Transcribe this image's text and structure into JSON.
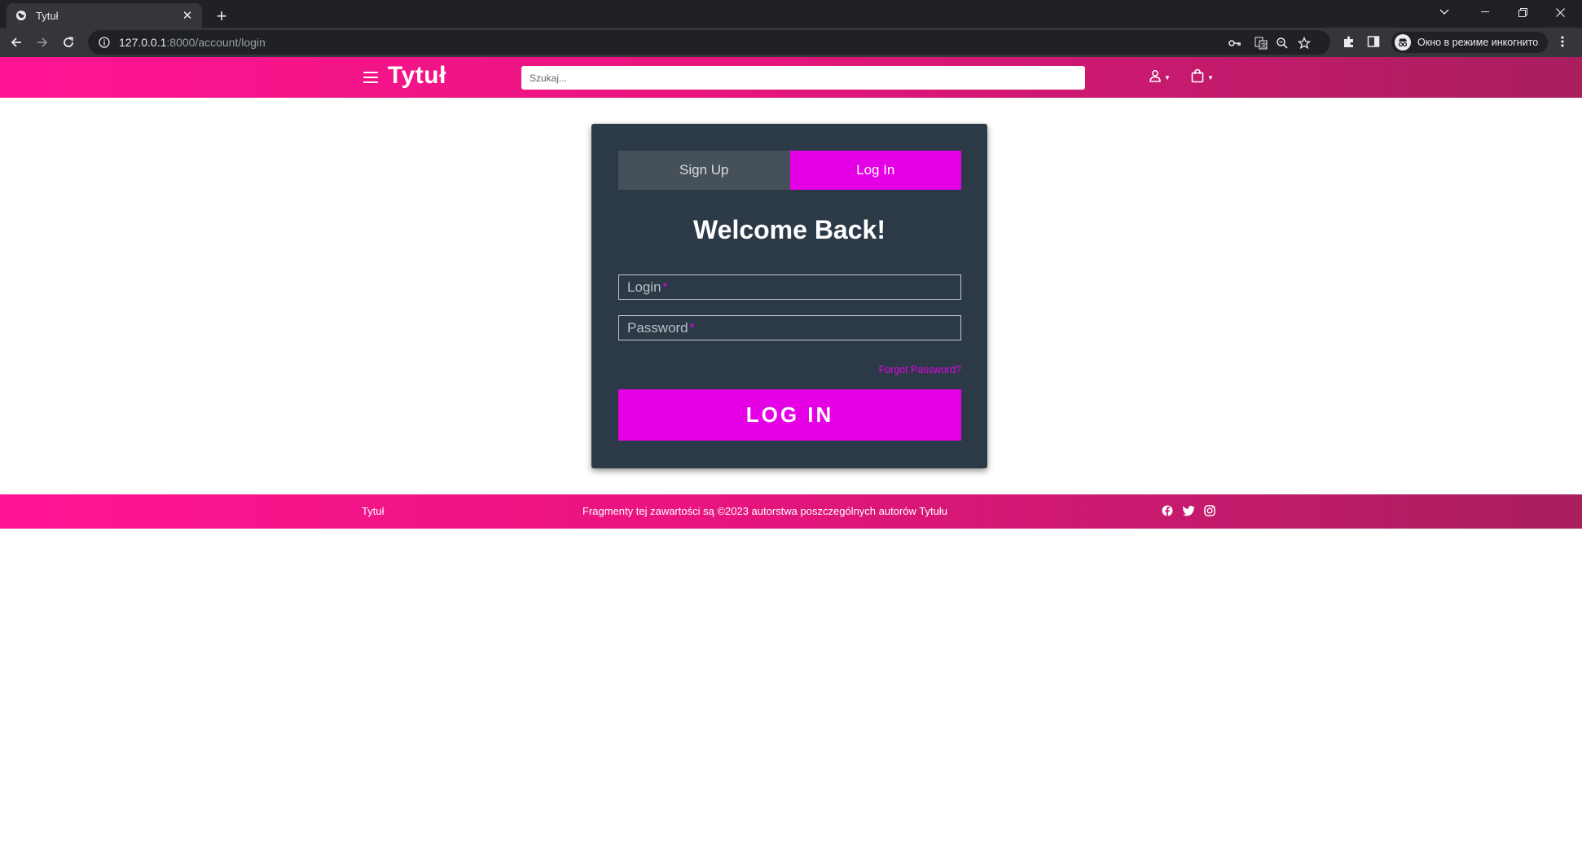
{
  "browser": {
    "tab_title": "Tytuł",
    "tab_close": "✕",
    "new_tab": "+",
    "url_host": "127.0.0.1",
    "url_rest": ":8000/account/login",
    "incognito_label": "Окно в режиме инкогнито"
  },
  "header": {
    "logo": "Tytuł",
    "search_placeholder": "Szukaj..."
  },
  "login_card": {
    "tab_signup": "Sign Up",
    "tab_login": "Log In",
    "heading": "Welcome Back!",
    "login_placeholder": "Login",
    "password_placeholder": "Password",
    "required_mark": "*",
    "forgot_password": "Forgot Password?",
    "submit_label": "LOG IN"
  },
  "footer": {
    "brand": "Tytuł",
    "copyright": "Fragmenty tej zawartości są ©2023 autorstwa poszczególnych autorów Tytułu",
    "social_icons": [
      "facebook-icon",
      "twitter-icon",
      "instagram-icon"
    ]
  },
  "colors": {
    "accent": "#e600e6",
    "header_gradient_start": "#ff1493",
    "header_gradient_end": "#a81f5e",
    "card_background": "#2c3a47",
    "signup_tab_background": "#465058"
  }
}
